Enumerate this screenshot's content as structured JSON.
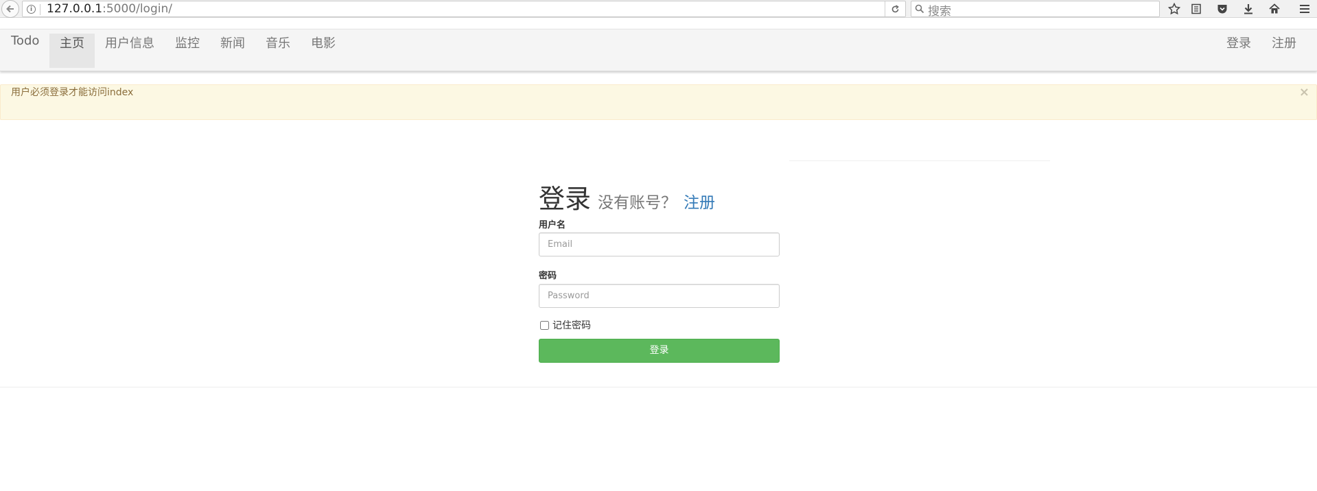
{
  "browser": {
    "url_host": "127.0.0.1",
    "url_path": ":5000/login/",
    "search_placeholder": "搜索"
  },
  "navbar": {
    "brand": "Todo",
    "items": [
      {
        "label": "主页",
        "active": true
      },
      {
        "label": "用户信息"
      },
      {
        "label": "监控"
      },
      {
        "label": "新闻"
      },
      {
        "label": "音乐"
      },
      {
        "label": "电影"
      }
    ],
    "right_items": [
      {
        "label": "登录"
      },
      {
        "label": "注册"
      }
    ]
  },
  "alert": {
    "message": "用户必须登录才能访问index",
    "close": "×"
  },
  "login": {
    "title": "登录",
    "subtitle": "没有账号？",
    "register_link": "注册",
    "username_label": "用户名",
    "username_placeholder": "Email",
    "password_label": "密码",
    "password_placeholder": "Password",
    "remember_label": "记住密码",
    "submit_label": "登录"
  },
  "colors": {
    "accent_link": "#337ab7",
    "submit_green": "#5cb85c",
    "alert_bg": "#fcf8e3",
    "alert_text": "#8a6d3b"
  }
}
